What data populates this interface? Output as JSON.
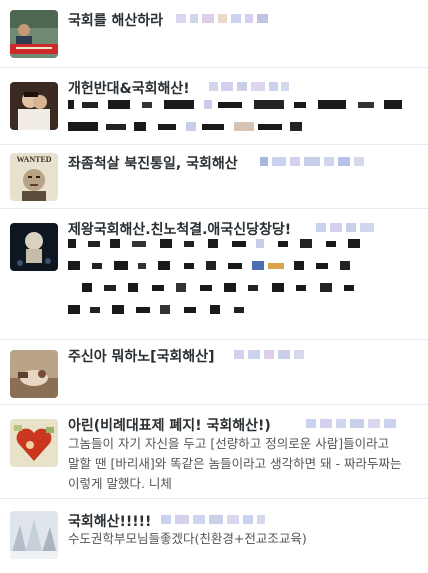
{
  "accounts": [
    {
      "name": "국회를 해산하라",
      "text": ""
    },
    {
      "name": "개헌반대&국회해산!",
      "text": ""
    },
    {
      "name": "좌좀척살 북진통일, 국회해산",
      "text": ""
    },
    {
      "name": "제왕국회해산.친노척결.애국신당창당!",
      "text": ""
    },
    {
      "name": "주신아 뭐하노[국회해산]",
      "text": ""
    },
    {
      "name": "아린(비례대표제 폐지! 국회해산!)",
      "text": "그놈들이 자기 자신을 두고 [선량하고 정의로운 사람]들이라고 말할 땐 [바리새]와 똑같은 놈들이라고 생각하면 돼 - 짜라두짜는 이렇게 말했다. 니체"
    },
    {
      "name": "국회해산!!!!!",
      "text": "수도권학부모님들좋겠다(친환경+전교조교육)"
    }
  ],
  "avatar_labels": {
    "wanted": "WANTED"
  },
  "colors": {
    "divider": "#e6ecf0",
    "blur_dark": "#1a1a1a",
    "blur_light": "#c8cde8"
  }
}
